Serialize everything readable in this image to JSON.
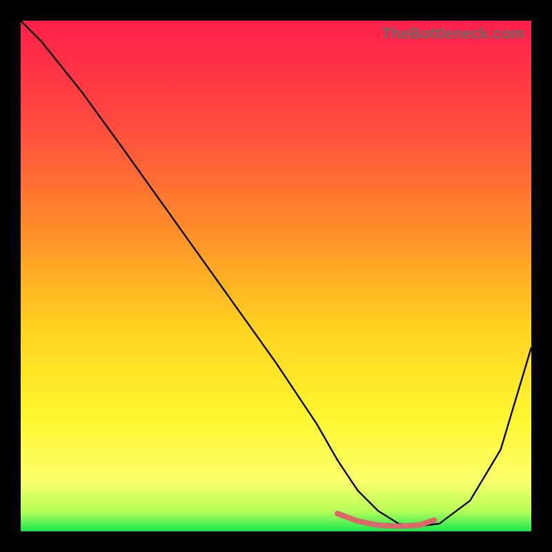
{
  "watermark": "TheBottleneck.com",
  "chart_data": {
    "type": "line",
    "title": "",
    "xlabel": "",
    "ylabel": "",
    "xlim": [
      0,
      100
    ],
    "ylim": [
      0,
      100
    ],
    "gradient_stops": [
      {
        "offset": 0,
        "color": "#ff1f4b"
      },
      {
        "offset": 20,
        "color": "#ff4a3f"
      },
      {
        "offset": 40,
        "color": "#ff8a2a"
      },
      {
        "offset": 60,
        "color": "#ffd21f"
      },
      {
        "offset": 78,
        "color": "#fff731"
      },
      {
        "offset": 90,
        "color": "#fbff6a"
      },
      {
        "offset": 96,
        "color": "#b8ff5a"
      },
      {
        "offset": 100,
        "color": "#17e84f"
      }
    ],
    "series": [
      {
        "name": "curve",
        "x": [
          0,
          4,
          8,
          12,
          20,
          30,
          40,
          50,
          58,
          62,
          66,
          70,
          74,
          78,
          82,
          88,
          94,
          100
        ],
        "y": [
          100,
          96,
          91,
          86,
          75,
          61,
          47,
          33,
          21,
          14,
          8,
          4,
          1.5,
          1,
          1.5,
          6,
          16,
          36
        ]
      }
    ],
    "highlight": {
      "color": "#d96a6a",
      "x": [
        62,
        66,
        70,
        74,
        78,
        81
      ],
      "y": [
        3.5,
        2,
        1.2,
        1,
        1.2,
        2.2
      ]
    }
  }
}
